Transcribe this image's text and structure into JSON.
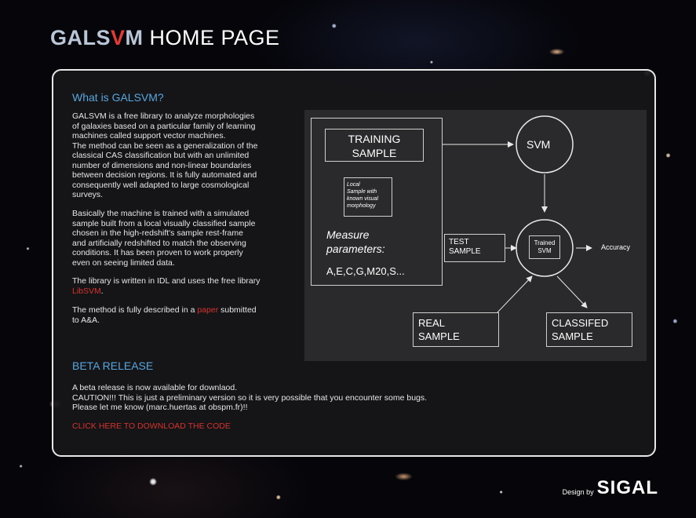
{
  "header": {
    "logo_prefix": "GALS",
    "logo_v": "V",
    "logo_m": "M",
    "title": "HOME PAGE"
  },
  "what_is": {
    "title": "What is GALSVM?",
    "para1": "GALSVM is a free library to analyze morphologies\nof galaxies based on a particular family of learning\nmachines called support vector machines.\nThe method can be seen as a generalization of the\nclassical CAS classification but with an unlimited\nnumber of dimensions and non-linear boundaries\nbetween decision regions. It is fully automated and\nconsequently well adapted to large cosmological\nsurveys.",
    "para2": "Basically the machine is trained with a simulated\nsample built from a local visually classified sample\nchosen in the high-redshift's sample rest-frame\nand artificially redshifted to match the observing\nconditions.  It has been proven to work properly\neven on seeing limited data.",
    "para3_prefix": "The library is written in IDL and uses the free library",
    "para3_link": "LibSVM",
    "para3_suffix": ".",
    "para4_prefix": "The method is fully described in a",
    "para4_link": "paper",
    "para4_suffix": "submitted",
    "para4_line2": "to A&A."
  },
  "diagram": {
    "training_sample_1": "TRAINING",
    "training_sample_2": "SAMPLE",
    "local_sample_1": "Local",
    "local_sample_2": "Sample with",
    "local_sample_3": "known visual",
    "local_sample_4": "morphology",
    "measure_1": "Measure",
    "measure_2": "parameters:",
    "params": "A,E,C,G,M20,S...",
    "svm": "SVM",
    "test_1": "TEST",
    "test_2": "SAMPLE",
    "trained_1": "Trained",
    "trained_2": "SVM",
    "accuracy": "Accuracy",
    "real_1": "REAL",
    "real_2": "SAMPLE",
    "classified_1": "CLASSIFED",
    "classified_2": "SAMPLE"
  },
  "beta": {
    "title": "BETA RELEASE",
    "text": "A beta release is now available for downlaod.\nCAUTION!!! This is just a preliminary version so it is very possible that you encounter some bugs.\nPlease let me know (marc.huertas at obspm.fr)!!",
    "download_link": "CLICK HERE TO DOWNLOAD THE CODE"
  },
  "footer": {
    "design_by": "Design by",
    "brand": "SIGAL"
  },
  "colors": {
    "accent_blue": "#58a6df",
    "link_red": "#d6332d",
    "panel_border": "#e8e8e8"
  }
}
